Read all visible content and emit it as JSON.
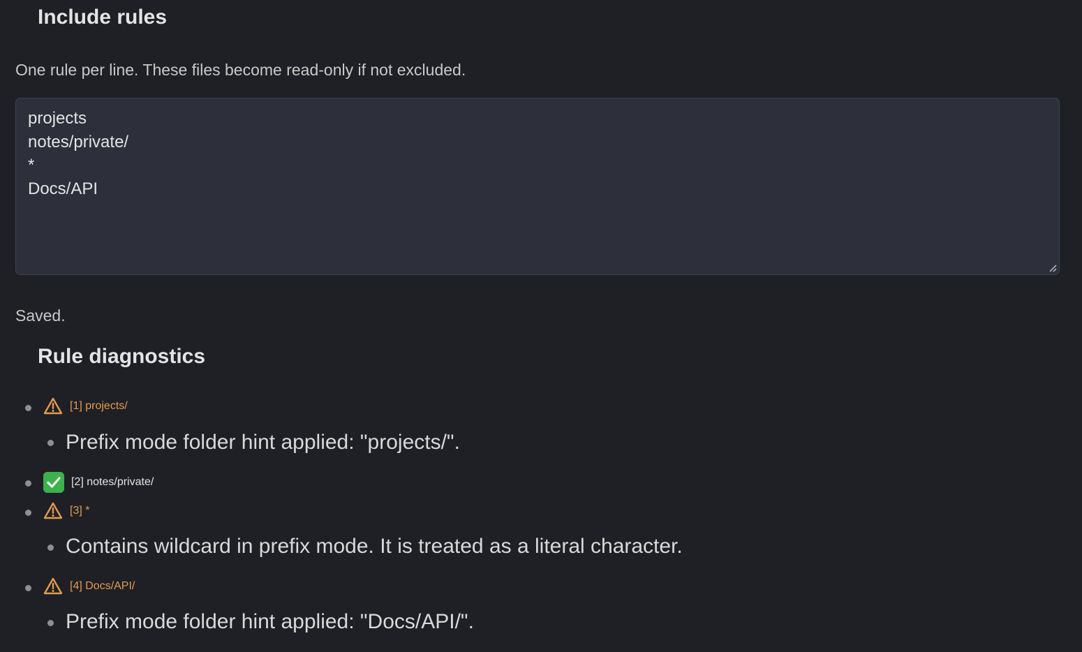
{
  "include": {
    "title": "Include rules",
    "description": "One rule per line. These files become read-only if not excluded.",
    "rules": [
      "projects",
      "notes/private/",
      "*",
      "Docs/API"
    ]
  },
  "status": "Saved.",
  "diagnostics": {
    "title": "Rule diagnostics",
    "items": [
      {
        "status": "warning",
        "label": "[1] projects/",
        "detail": "Prefix mode folder hint applied: \"projects/\"."
      },
      {
        "status": "ok",
        "label": "[2] notes/private/",
        "detail": ""
      },
      {
        "status": "warning",
        "label": "[3] *",
        "detail": "Contains wildcard in prefix mode. It is treated as a literal character."
      },
      {
        "status": "warning",
        "label": "[4] Docs/API/",
        "detail": "Prefix mode folder hint applied: \"Docs/API/\"."
      }
    ]
  },
  "colors": {
    "background": "#1e2025",
    "warning": "#e49b4f",
    "ok": "#3db14b",
    "textarea_bg": "#2d303a"
  },
  "icons": {
    "warning": "warning-triangle-icon",
    "ok": "check-mark-icon"
  }
}
